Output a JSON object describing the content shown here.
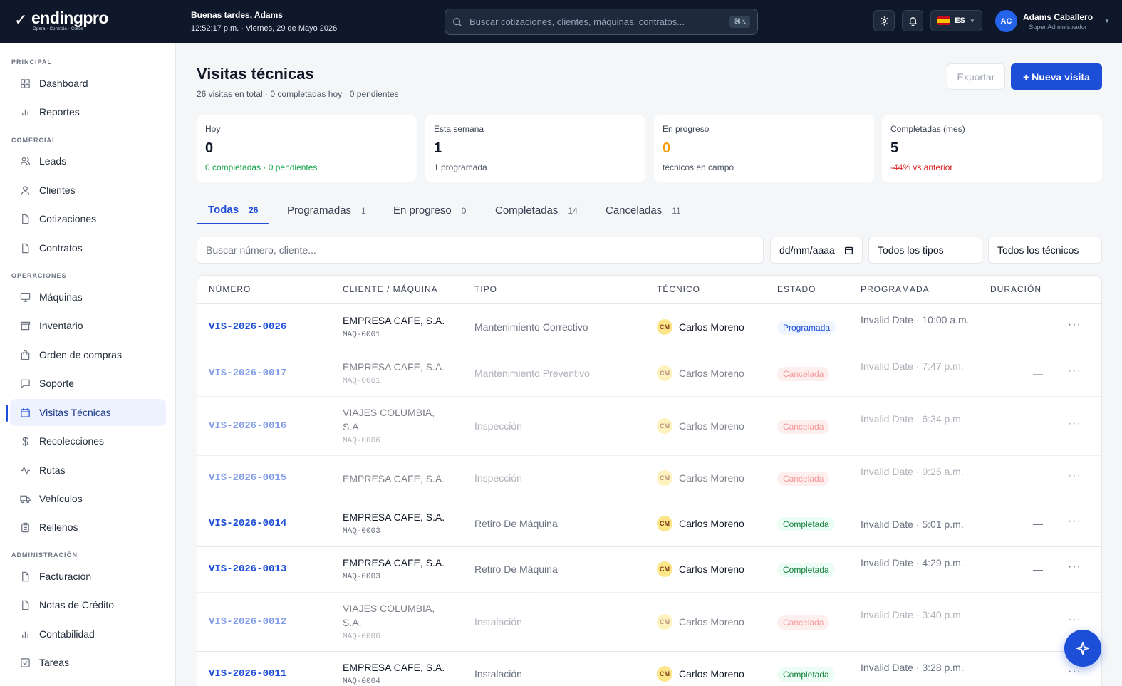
{
  "brand": {
    "name": "endingpro",
    "tagline": "Opera · Controla · Crece"
  },
  "header": {
    "greeting": "Buenas tardes, Adams",
    "datetime": "12:52:17 p.m. · Viernes, 29 de Mayo 2026",
    "search_placeholder": "Buscar cotizaciones, clientes, máquinas, contratos...",
    "shortcut": "⌘K",
    "language": "ES",
    "user_initials": "AC",
    "user_name": "Adams Caballero",
    "user_role": "Super Administrador"
  },
  "sidebar": {
    "sections": [
      {
        "label": "PRINCIPAL"
      },
      {
        "label": "COMERCIAL"
      },
      {
        "label": "OPERACIONES"
      },
      {
        "label": "ADMINISTRACIÓN"
      }
    ],
    "items": [
      {
        "label": "Dashboard",
        "icon": "grid-icon"
      },
      {
        "label": "Reportes",
        "icon": "bar-chart-icon"
      },
      {
        "label": "Leads",
        "icon": "users-icon"
      },
      {
        "label": "Clientes",
        "icon": "user-icon"
      },
      {
        "label": "Cotizaciones",
        "icon": "file-icon"
      },
      {
        "label": "Contratos",
        "icon": "file-icon"
      },
      {
        "label": "Máquinas",
        "icon": "monitor-icon"
      },
      {
        "label": "Inventario",
        "icon": "archive-icon"
      },
      {
        "label": "Orden de compras",
        "icon": "bag-icon"
      },
      {
        "label": "Soporte",
        "icon": "chat-icon"
      },
      {
        "label": "Visitas Técnicas",
        "icon": "calendar-icon",
        "active": true
      },
      {
        "label": "Recolecciones",
        "icon": "dollar-icon"
      },
      {
        "label": "Rutas",
        "icon": "activity-icon"
      },
      {
        "label": "Vehículos",
        "icon": "truck-icon"
      },
      {
        "label": "Rellenos",
        "icon": "clipboard-icon"
      },
      {
        "label": "Facturación",
        "icon": "file-icon"
      },
      {
        "label": "Notas de Crédito",
        "icon": "file-icon"
      },
      {
        "label": "Contabilidad",
        "icon": "bar-chart-icon"
      },
      {
        "label": "Tareas",
        "icon": "check-square-icon"
      }
    ]
  },
  "page": {
    "title": "Visitas técnicas",
    "subtitle": "26 visitas en total · 0 completadas hoy · 0 pendientes",
    "export_label": "Exportar",
    "new_label": "+ Nueva visita"
  },
  "cards": [
    {
      "label": "Hoy",
      "value": "0",
      "note": "0 completadas · 0 pendientes",
      "value_color": "#111827",
      "note_color": "#16a34a"
    },
    {
      "label": "Esta semana",
      "value": "1",
      "note": "1 programada",
      "value_color": "#111827",
      "note_color": "#4b5563"
    },
    {
      "label": "En progreso",
      "value": "0",
      "note": "técnicos en campo",
      "value_color": "#f59e0b",
      "note_color": "#4b5563"
    },
    {
      "label": "Completadas (mes)",
      "value": "5",
      "note": "-44% vs anterior",
      "value_color": "#111827",
      "note_color": "#dc2626"
    }
  ],
  "tabs": [
    {
      "label": "Todas",
      "count": "26",
      "active": true
    },
    {
      "label": "Programadas",
      "count": "1"
    },
    {
      "label": "En progreso",
      "count": "0"
    },
    {
      "label": "Completadas",
      "count": "14"
    },
    {
      "label": "Canceladas",
      "count": "11"
    }
  ],
  "filters": {
    "search_placeholder": "Buscar número, cliente...",
    "date_placeholder": "dd/mm/aaaa",
    "type": "Todos los tipos",
    "tech": "Todos los técnicos"
  },
  "table": {
    "headers": [
      "NÚMERO",
      "CLIENTE / MÁQUINA",
      "TIPO",
      "TÉCNICO",
      "ESTADO",
      "PROGRAMADA",
      "DURACIÓN"
    ],
    "rows": [
      {
        "num": "VIS-2026-0026",
        "client": "EMPRESA CAFE, S.A.",
        "machine": "MAQ-0001",
        "type": "Mantenimiento Correctivo",
        "tech_initials": "CM",
        "tech": "Carlos Moreno",
        "status": "Programada",
        "status_kind": "prog",
        "scheduled": "Invalid Date · 10:00 a.m.",
        "duration": "—"
      },
      {
        "num": "VIS-2026-0017",
        "client": "EMPRESA CAFE, S.A.",
        "machine": "MAQ-0001",
        "type": "Mantenimiento Preventivo",
        "tech_initials": "CM",
        "tech": "Carlos Moreno",
        "status": "Cancelada",
        "status_kind": "canc",
        "scheduled": "Invalid Date · 7:47 p.m.",
        "duration": "—"
      },
      {
        "num": "VIS-2026-0016",
        "client": "VIAJES COLUMBIA, S.A.",
        "machine": "MAQ-0006",
        "type": "Inspección",
        "tech_initials": "CM",
        "tech": "Carlos Moreno",
        "status": "Cancelada",
        "status_kind": "canc",
        "scheduled": "Invalid Date · 6:34 p.m.",
        "duration": "—"
      },
      {
        "num": "VIS-2026-0015",
        "client": "EMPRESA CAFE, S.A.",
        "machine": "",
        "type": "Inspección",
        "tech_initials": "CM",
        "tech": "Carlos Moreno",
        "status": "Cancelada",
        "status_kind": "canc",
        "scheduled": "Invalid Date · 9:25 a.m.",
        "duration": "—"
      },
      {
        "num": "VIS-2026-0014",
        "client": "EMPRESA CAFE, S.A.",
        "machine": "MAQ-0003",
        "type": "Retiro De Máquina",
        "tech_initials": "CM",
        "tech": "Carlos Moreno",
        "status": "Completada",
        "status_kind": "comp",
        "scheduled": "Invalid Date · 5:01 p.m.",
        "duration": "—"
      },
      {
        "num": "VIS-2026-0013",
        "client": "EMPRESA CAFE, S.A.",
        "machine": "MAQ-0003",
        "type": "Retiro De Máquina",
        "tech_initials": "CM",
        "tech": "Carlos Moreno",
        "status": "Completada",
        "status_kind": "comp",
        "scheduled": "Invalid Date · 4:29 p.m.",
        "duration": "—"
      },
      {
        "num": "VIS-2026-0012",
        "client": "VIAJES COLUMBIA, S.A.",
        "machine": "MAQ-0006",
        "type": "Instalación",
        "tech_initials": "CM",
        "tech": "Carlos Moreno",
        "status": "Cancelada",
        "status_kind": "canc",
        "scheduled": "Invalid Date · 3:40 p.m.",
        "duration": "—"
      },
      {
        "num": "VIS-2026-0011",
        "client": "EMPRESA CAFE, S.A.",
        "machine": "MAQ-0004",
        "type": "Instalación",
        "tech_initials": "CM",
        "tech": "Carlos Moreno",
        "status": "Completada",
        "status_kind": "comp",
        "scheduled": "Invalid Date · 3:28 p.m.",
        "duration": "—"
      }
    ]
  },
  "fab_icon": "sparkle-icon"
}
